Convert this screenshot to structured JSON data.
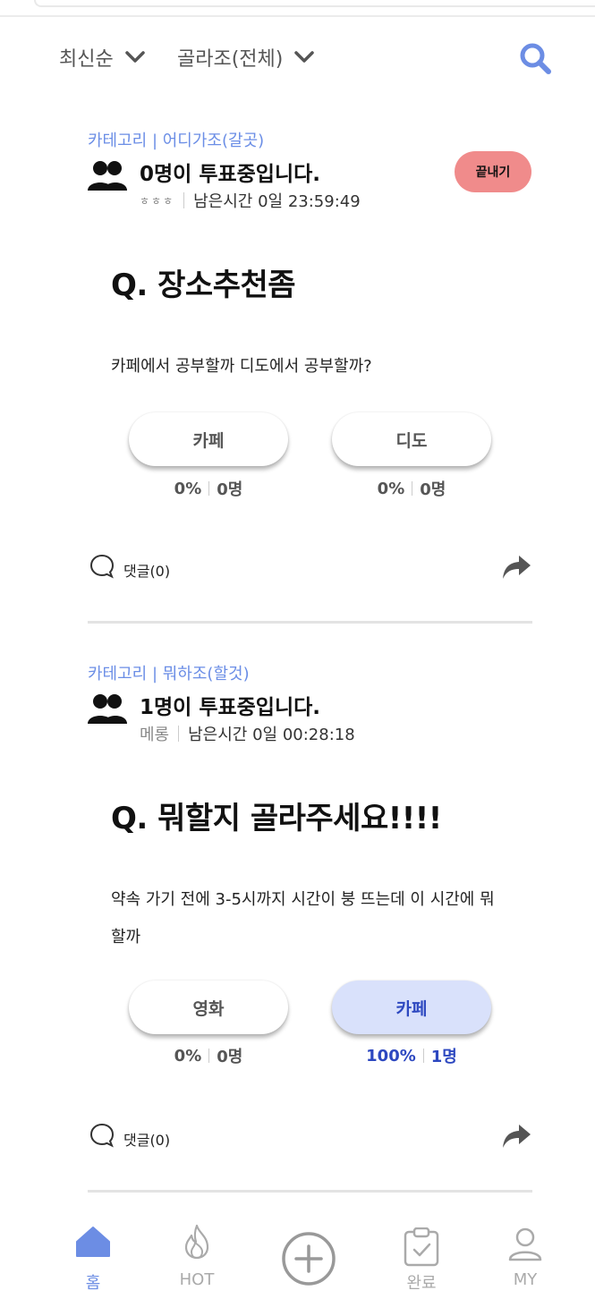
{
  "filters": {
    "sort_label": "최신순",
    "group_label": "골라조(전체)"
  },
  "posts": [
    {
      "category": "카테고리 | 어디가조(갈곳)",
      "voting_count": "0명이 투표중입니다.",
      "author": "ㅎㅎㅎ",
      "time_left": "남은시간 0일 23:59:49",
      "end_label": "끝내기",
      "question": "Q. 장소추천좀",
      "description": "카페에서 공부할까 디도에서 공부할까?",
      "options": [
        {
          "label": "카페",
          "percent": "0%",
          "count": "0명",
          "selected": false
        },
        {
          "label": "디도",
          "percent": "0%",
          "count": "0명",
          "selected": false
        }
      ],
      "comments": "댓글(0)"
    },
    {
      "category": "카테고리 | 뭐하조(할것)",
      "voting_count": "1명이 투표중입니다.",
      "author": "메롱",
      "time_left": "남은시간 0일 00:28:18",
      "question": "Q. 뭐할지 골라주세요!!!!",
      "description": "약속 가기 전에 3-5시까지 시간이 붕 뜨는데 이 시간에 뭐할까",
      "options": [
        {
          "label": "영화",
          "percent": "0%",
          "count": "0명",
          "selected": false
        },
        {
          "label": "카페",
          "percent": "100%",
          "count": "1명",
          "selected": true
        }
      ],
      "comments": "댓글(0)"
    }
  ],
  "nav": {
    "home": "홈",
    "hot": "HOT",
    "done": "완료",
    "my": "MY"
  },
  "colors": {
    "accent": "#6c8de4",
    "end_button": "#f08b8b",
    "selected_option_bg": "#d9e1fb",
    "selected_text": "#2d48c0"
  },
  "icons": [
    "chevron-down-icon",
    "search-icon",
    "people-icon",
    "comment-icon",
    "share-icon",
    "home-icon",
    "flame-icon",
    "plus-circle-icon",
    "clipboard-check-icon",
    "user-icon"
  ]
}
